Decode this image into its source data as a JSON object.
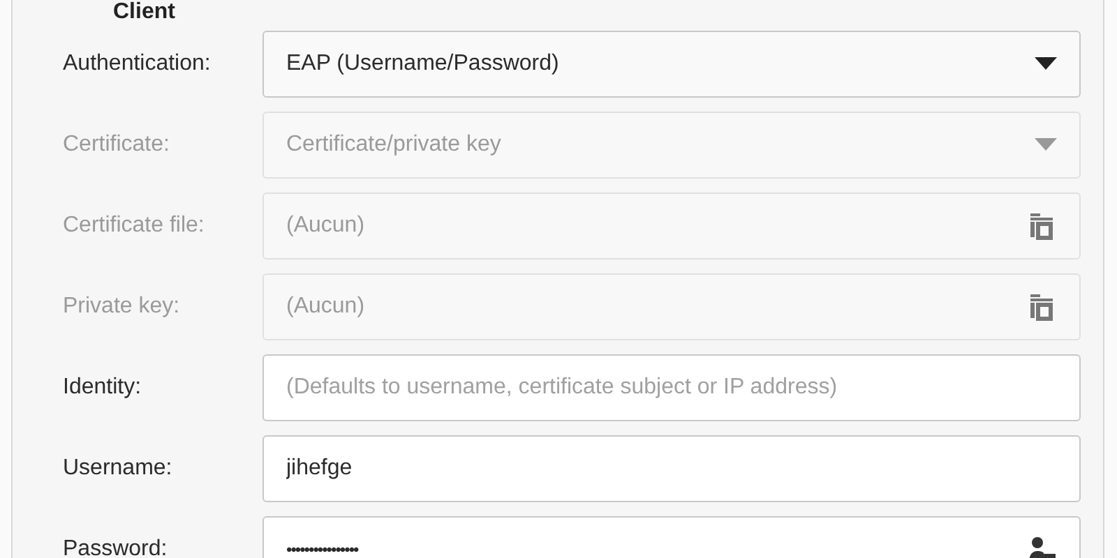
{
  "section_title": "Client",
  "rows": [
    {
      "kind": "dropdown",
      "label": "Authentication:",
      "value": "EAP (Username/Password)",
      "disabled": false
    },
    {
      "kind": "dropdown",
      "label": "Certificate:",
      "value": "Certificate/private key",
      "disabled": true
    },
    {
      "kind": "file",
      "label": "Certificate file:",
      "value": "(Aucun)",
      "disabled": true
    },
    {
      "kind": "file",
      "label": "Private key:",
      "value": "(Aucun)",
      "disabled": true
    },
    {
      "kind": "text",
      "label": "Identity:",
      "placeholder": "(Defaults to username, certificate subject or IP address)",
      "disabled": false
    },
    {
      "kind": "text",
      "label": "Username:",
      "value": "jihefge",
      "disabled": false
    },
    {
      "kind": "password",
      "label": "Password:",
      "value": "••••••••••••••••",
      "disabled": false
    }
  ]
}
